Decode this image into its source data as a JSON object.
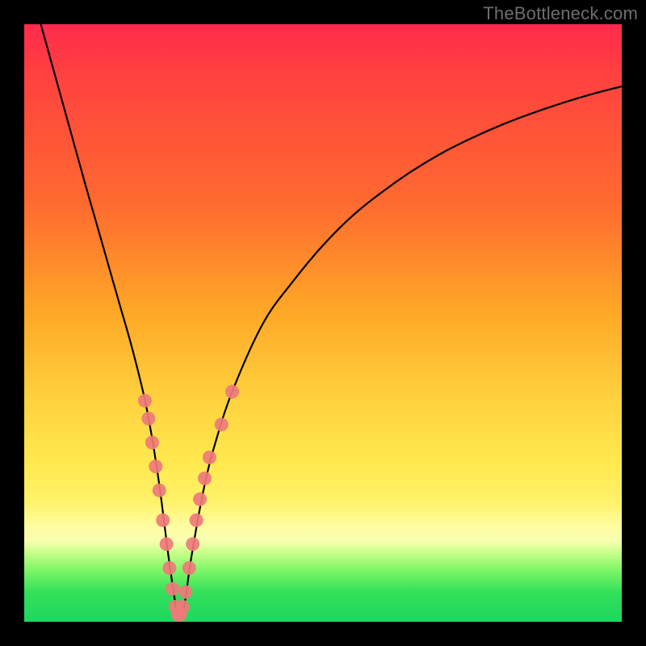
{
  "watermark": "TheBottleneck.com",
  "chart_data": {
    "type": "line",
    "title": "",
    "xlabel": "",
    "ylabel": "",
    "xlim": [
      0,
      100
    ],
    "ylim": [
      0,
      100
    ],
    "series": [
      {
        "name": "bottleneck-curve",
        "x": [
          0,
          5,
          10,
          12,
          14,
          16,
          18,
          20,
          21,
          22,
          23,
          24,
          25,
          25.7,
          26.4,
          27,
          28,
          30,
          32,
          35,
          40,
          45,
          50,
          55,
          60,
          65,
          70,
          75,
          80,
          85,
          90,
          95,
          100
        ],
        "y": [
          110,
          92,
          74,
          67,
          60,
          53,
          46,
          38,
          33,
          27,
          20,
          12,
          5,
          1,
          1,
          4,
          11,
          22,
          30,
          39,
          50,
          57,
          63,
          68,
          72,
          75.5,
          78.5,
          81,
          83.2,
          85.1,
          86.8,
          88.3,
          89.6
        ]
      }
    ],
    "markers": {
      "name": "highlight-dots",
      "color": "#ef7a7a",
      "points": [
        {
          "x": 20.2,
          "y": 37
        },
        {
          "x": 20.8,
          "y": 34
        },
        {
          "x": 21.4,
          "y": 30
        },
        {
          "x": 22.0,
          "y": 26
        },
        {
          "x": 22.6,
          "y": 22
        },
        {
          "x": 23.2,
          "y": 17
        },
        {
          "x": 23.8,
          "y": 13
        },
        {
          "x": 24.3,
          "y": 9
        },
        {
          "x": 24.8,
          "y": 5.5
        },
        {
          "x": 25.3,
          "y": 2.5
        },
        {
          "x": 25.7,
          "y": 1.2
        },
        {
          "x": 26.1,
          "y": 1.2
        },
        {
          "x": 26.5,
          "y": 2.5
        },
        {
          "x": 27.0,
          "y": 5
        },
        {
          "x": 27.6,
          "y": 9
        },
        {
          "x": 28.2,
          "y": 13
        },
        {
          "x": 28.8,
          "y": 17
        },
        {
          "x": 29.4,
          "y": 20.5
        },
        {
          "x": 30.2,
          "y": 24
        },
        {
          "x": 31.0,
          "y": 27.5
        },
        {
          "x": 33.0,
          "y": 33
        },
        {
          "x": 34.8,
          "y": 38.5
        }
      ]
    },
    "gradient_stops_pct": {
      "red": 0,
      "orange": 48,
      "yellow": 73,
      "pale": 86,
      "green": 100
    }
  }
}
